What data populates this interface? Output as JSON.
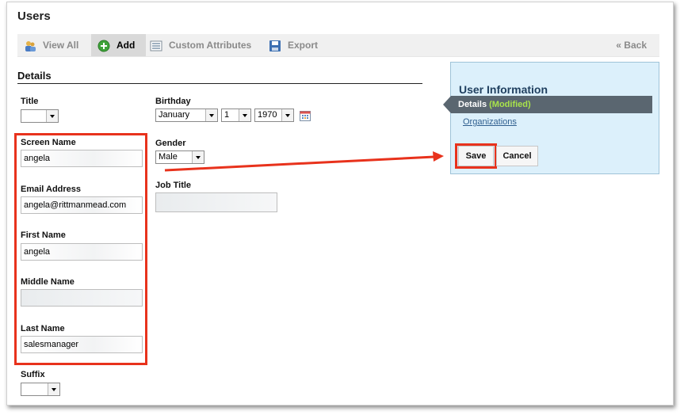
{
  "page": {
    "title": "Users"
  },
  "toolbar": {
    "view_all": "View All",
    "add": "Add",
    "custom_attributes": "Custom Attributes",
    "export": "Export",
    "back": "« Back"
  },
  "details": {
    "section_title": "Details",
    "title_label": "Title",
    "title_value": "",
    "screen_name_label": "Screen Name",
    "screen_name_value": "angela",
    "email_label": "Email Address",
    "email_value": "angela@rittmanmead.com",
    "first_name_label": "First Name",
    "first_name_value": "angela",
    "middle_name_label": "Middle Name",
    "middle_name_value": "",
    "last_name_label": "Last Name",
    "last_name_value": "salesmanager",
    "suffix_label": "Suffix",
    "suffix_value": "",
    "birthday_label": "Birthday",
    "birthday_month": "January",
    "birthday_day": "1",
    "birthday_year": "1970",
    "gender_label": "Gender",
    "gender_value": "Male",
    "job_title_label": "Job Title",
    "job_title_value": ""
  },
  "user_info": {
    "title": "User Information",
    "tab_label": "Details",
    "tab_modified": "(Modified)",
    "organizations_link": "Organizations",
    "save_label": "Save",
    "cancel_label": "Cancel"
  },
  "colors": {
    "highlight": "#e8321c",
    "panel_bg": "#dcf0fb",
    "modified": "#a9e34b"
  },
  "icons": [
    "users-icon",
    "add-icon",
    "custom-attributes-icon",
    "export-icon",
    "calendar-icon"
  ]
}
